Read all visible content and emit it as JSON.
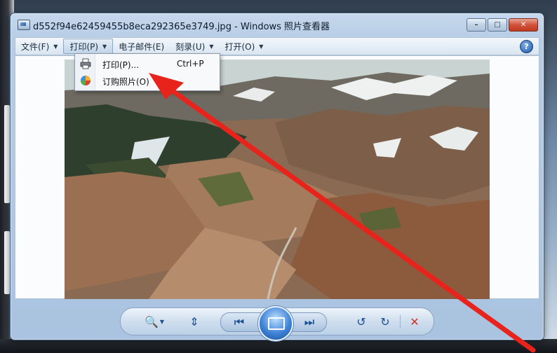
{
  "window": {
    "title": "d552f94e62459455b8eca292365e3749.jpg - Windows 照片查看器",
    "minimize_label": "–",
    "maximize_label": "□",
    "close_label": "✕"
  },
  "menubar": {
    "items": [
      {
        "label": "文件(F)",
        "has_caret": true
      },
      {
        "label": "打印(P)",
        "has_caret": true,
        "active": true
      },
      {
        "label": "电子邮件(E)",
        "has_caret": false
      },
      {
        "label": "刻录(U)",
        "has_caret": true
      },
      {
        "label": "打开(O)",
        "has_caret": true
      }
    ],
    "help_label": "?"
  },
  "print_menu": {
    "items": [
      {
        "label": "打印(P)...",
        "shortcut": "Ctrl+P",
        "icon": "printer-icon"
      },
      {
        "label": "订购照片(O)",
        "shortcut": "",
        "icon": "order-prints-icon"
      }
    ]
  },
  "photo": {
    "subject": "mountain-landscape",
    "icon": "photo-image"
  },
  "toolbar": {
    "buttons": [
      {
        "name": "zoom-button",
        "icon": "magnifier-plus-icon"
      },
      {
        "name": "actual-size-button",
        "icon": "fit-window-icon"
      },
      {
        "name": "previous-button",
        "icon": "previous-icon"
      },
      {
        "name": "slideshow-button",
        "icon": "slideshow-icon"
      },
      {
        "name": "next-button",
        "icon": "next-icon"
      },
      {
        "name": "rotate-counterclockwise-button",
        "icon": "rotate-left-icon"
      },
      {
        "name": "rotate-clockwise-button",
        "icon": "rotate-right-icon"
      },
      {
        "name": "delete-button",
        "icon": "delete-icon"
      }
    ]
  },
  "colors": {
    "arrow": "#e8231b",
    "delete": "#d9302b",
    "accent": "#1d58a8"
  }
}
